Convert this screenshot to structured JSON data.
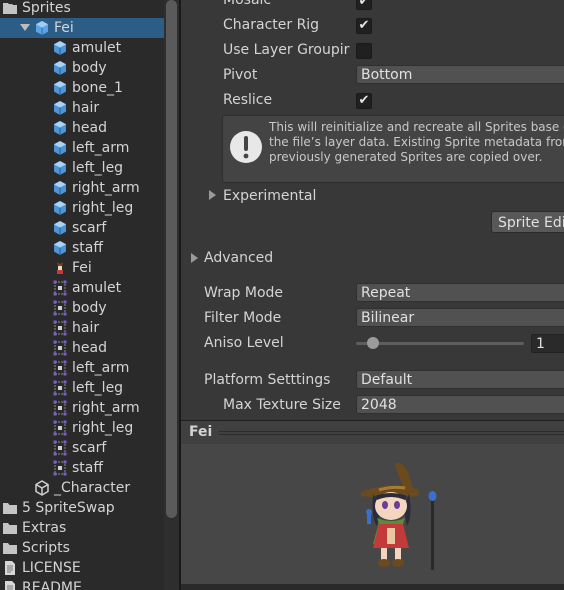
{
  "project": {
    "items": [
      {
        "label": "Sprites",
        "icon": "folder-icon",
        "indent": 0,
        "expanded": true
      },
      {
        "label": "Fei",
        "icon": "prefab-icon",
        "indent": 1,
        "expanded": true,
        "selected": true
      },
      {
        "label": "amulet",
        "icon": "sprite-cube-icon",
        "indent": 2
      },
      {
        "label": "body",
        "icon": "sprite-cube-icon",
        "indent": 2
      },
      {
        "label": "bone_1",
        "icon": "sprite-cube-icon",
        "indent": 2
      },
      {
        "label": "hair",
        "icon": "sprite-cube-icon",
        "indent": 2
      },
      {
        "label": "head",
        "icon": "sprite-cube-icon",
        "indent": 2
      },
      {
        "label": "left_arm",
        "icon": "sprite-cube-icon",
        "indent": 2
      },
      {
        "label": "left_leg",
        "icon": "sprite-cube-icon",
        "indent": 2
      },
      {
        "label": "right_arm",
        "icon": "sprite-cube-icon",
        "indent": 2
      },
      {
        "label": "right_leg",
        "icon": "sprite-cube-icon",
        "indent": 2
      },
      {
        "label": "scarf",
        "icon": "sprite-cube-icon",
        "indent": 2
      },
      {
        "label": "staff",
        "icon": "sprite-cube-icon",
        "indent": 2
      },
      {
        "label": "Fei",
        "icon": "character-icon",
        "indent": 2
      },
      {
        "label": "amulet",
        "icon": "sprite-rect-icon",
        "indent": 2
      },
      {
        "label": "body",
        "icon": "sprite-rect-icon",
        "indent": 2
      },
      {
        "label": "hair",
        "icon": "sprite-rect-icon",
        "indent": 2
      },
      {
        "label": "head",
        "icon": "sprite-rect-icon",
        "indent": 2
      },
      {
        "label": "left_arm",
        "icon": "sprite-rect-icon",
        "indent": 2
      },
      {
        "label": "left_leg",
        "icon": "sprite-rect-icon",
        "indent": 2
      },
      {
        "label": "right_arm",
        "icon": "sprite-rect-icon",
        "indent": 2
      },
      {
        "label": "right_leg",
        "icon": "sprite-rect-icon",
        "indent": 2
      },
      {
        "label": "scarf",
        "icon": "sprite-rect-icon",
        "indent": 2
      },
      {
        "label": "staff",
        "icon": "sprite-rect-icon",
        "indent": 2
      },
      {
        "label": "_Character",
        "icon": "unity-scene-icon",
        "indent": 1
      },
      {
        "label": "5 SpriteSwap",
        "icon": "folder-icon",
        "indent": 0
      },
      {
        "label": "Extras",
        "icon": "folder-icon",
        "indent": 0
      },
      {
        "label": "Scripts",
        "icon": "folder-icon",
        "indent": 0
      },
      {
        "label": "LICENSE",
        "icon": "document-icon",
        "indent": 0
      },
      {
        "label": "README",
        "icon": "document-icon",
        "indent": 0
      }
    ]
  },
  "inspector": {
    "mosaic_label": "Mosaic",
    "mosaic_checked": true,
    "character_rig_label": "Character Rig",
    "character_rig_checked": true,
    "use_layer_grouping_label": "Use Layer Groupir",
    "use_layer_grouping_checked": false,
    "pivot_label": "Pivot",
    "pivot_value": "Bottom",
    "reslice_label": "Reslice",
    "reslice_checked": true,
    "info_text": "This will reinitialize and recreate all Sprites base on the file’s layer data. Existing Sprite metadata from previously generated Sprites are copied over.",
    "experimental_label": "Experimental",
    "sprite_editor_button": "Sprite Edi",
    "advanced_label": "Advanced",
    "wrap_mode_label": "Wrap Mode",
    "wrap_mode_value": "Repeat",
    "filter_mode_label": "Filter Mode",
    "filter_mode_value": "Bilinear",
    "aniso_level_label": "Aniso Level",
    "aniso_level_value": "1",
    "aniso_slider_fraction": 0.1,
    "platform_settings_label": "Platform Setttings",
    "platform_settings_value": "Default",
    "max_texture_size_label": "Max Texture Size",
    "max_texture_size_value": "2048"
  },
  "preview": {
    "title": "Fei"
  },
  "colors": {
    "selection": "#2c5d87",
    "panel_bg": "#383838",
    "project_bg": "#2a2a2a"
  }
}
